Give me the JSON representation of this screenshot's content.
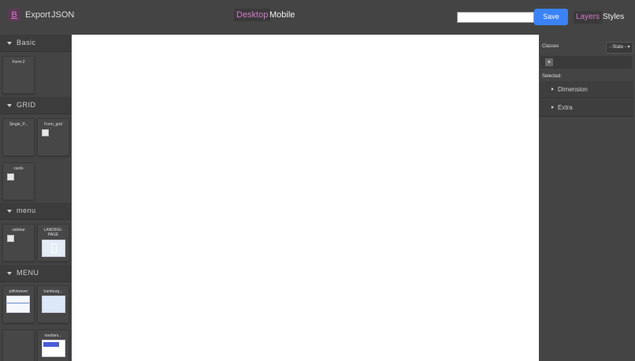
{
  "topbar": {
    "logo_letter": "B",
    "export_label": "Export",
    "json_label": "JSON",
    "devices": [
      "Desktop",
      "Mobile"
    ],
    "active_device": "Desktop",
    "search_value": "",
    "save_label": "Save",
    "tabs": [
      "Layers",
      "Styles"
    ],
    "active_tab": "Layers"
  },
  "blocks": {
    "categories": [
      {
        "label": "Basic",
        "items": [
          "Form-2"
        ]
      },
      {
        "label": "GRID",
        "items": [
          "Single_P...",
          "Form_grid",
          "cards"
        ]
      },
      {
        "label": "menu",
        "items": [
          "sidebar",
          "LANDING-PAGE"
        ]
      },
      {
        "label": "MENU",
        "items": [
          "pdfviewver",
          "hamburg...",
          "",
          "navbars..."
        ]
      }
    ]
  },
  "styles_panel": {
    "classes_label": "Classes",
    "state_label": "- State -",
    "add_icon": "plus-icon",
    "selected_label": "Selected:",
    "sectors": [
      "Dimension",
      "Extra"
    ]
  },
  "colors": {
    "accent": "#d278c9",
    "save_button": "#3b82f6",
    "panel_bg": "#444444",
    "canvas_bg": "#ffffff"
  }
}
